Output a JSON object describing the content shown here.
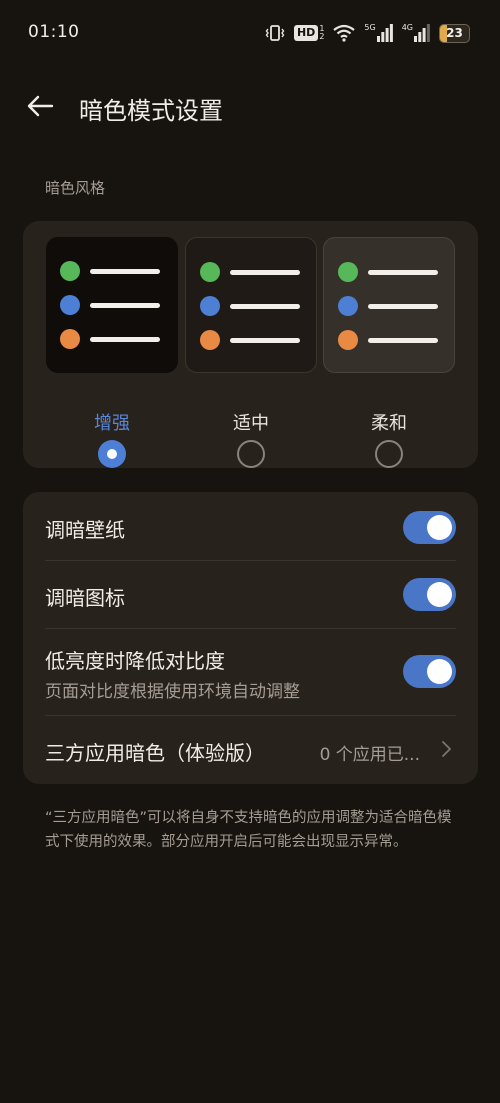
{
  "status_bar": {
    "time": "01:10",
    "hd_label": "HD",
    "hd_sub_top": "1",
    "hd_sub_bottom": "2",
    "net1_label": "5G",
    "net2_label": "4G",
    "battery_level": "23",
    "battery_fraction": 0.23,
    "battery_color": "#e0a94a"
  },
  "header": {
    "title": "暗色模式设置"
  },
  "dark_style": {
    "section_label": "暗色风格",
    "options": [
      {
        "label": "增强",
        "selected": true
      },
      {
        "label": "适中",
        "selected": false
      },
      {
        "label": "柔和",
        "selected": false
      }
    ],
    "dot_colors": [
      "#57b85a",
      "#4d7fd4",
      "#e98a44"
    ],
    "accent": "#5a86d8"
  },
  "settings": {
    "dim_wallpaper": {
      "title": "调暗壁纸",
      "enabled": true
    },
    "dim_icons": {
      "title": "调暗图标",
      "enabled": true
    },
    "reduce_contrast": {
      "title": "低亮度时降低对比度",
      "subtitle": "页面对比度根据使用环境自动调整",
      "enabled": true
    },
    "third_party": {
      "title": "三方应用暗色（体验版）",
      "value": "0 个应用已..."
    }
  },
  "footnote": "“三方应用暗色”可以将自身不支持暗色的应用调整为适合暗色模式下使用的效果。部分应用开启后可能会出现显示异常。"
}
